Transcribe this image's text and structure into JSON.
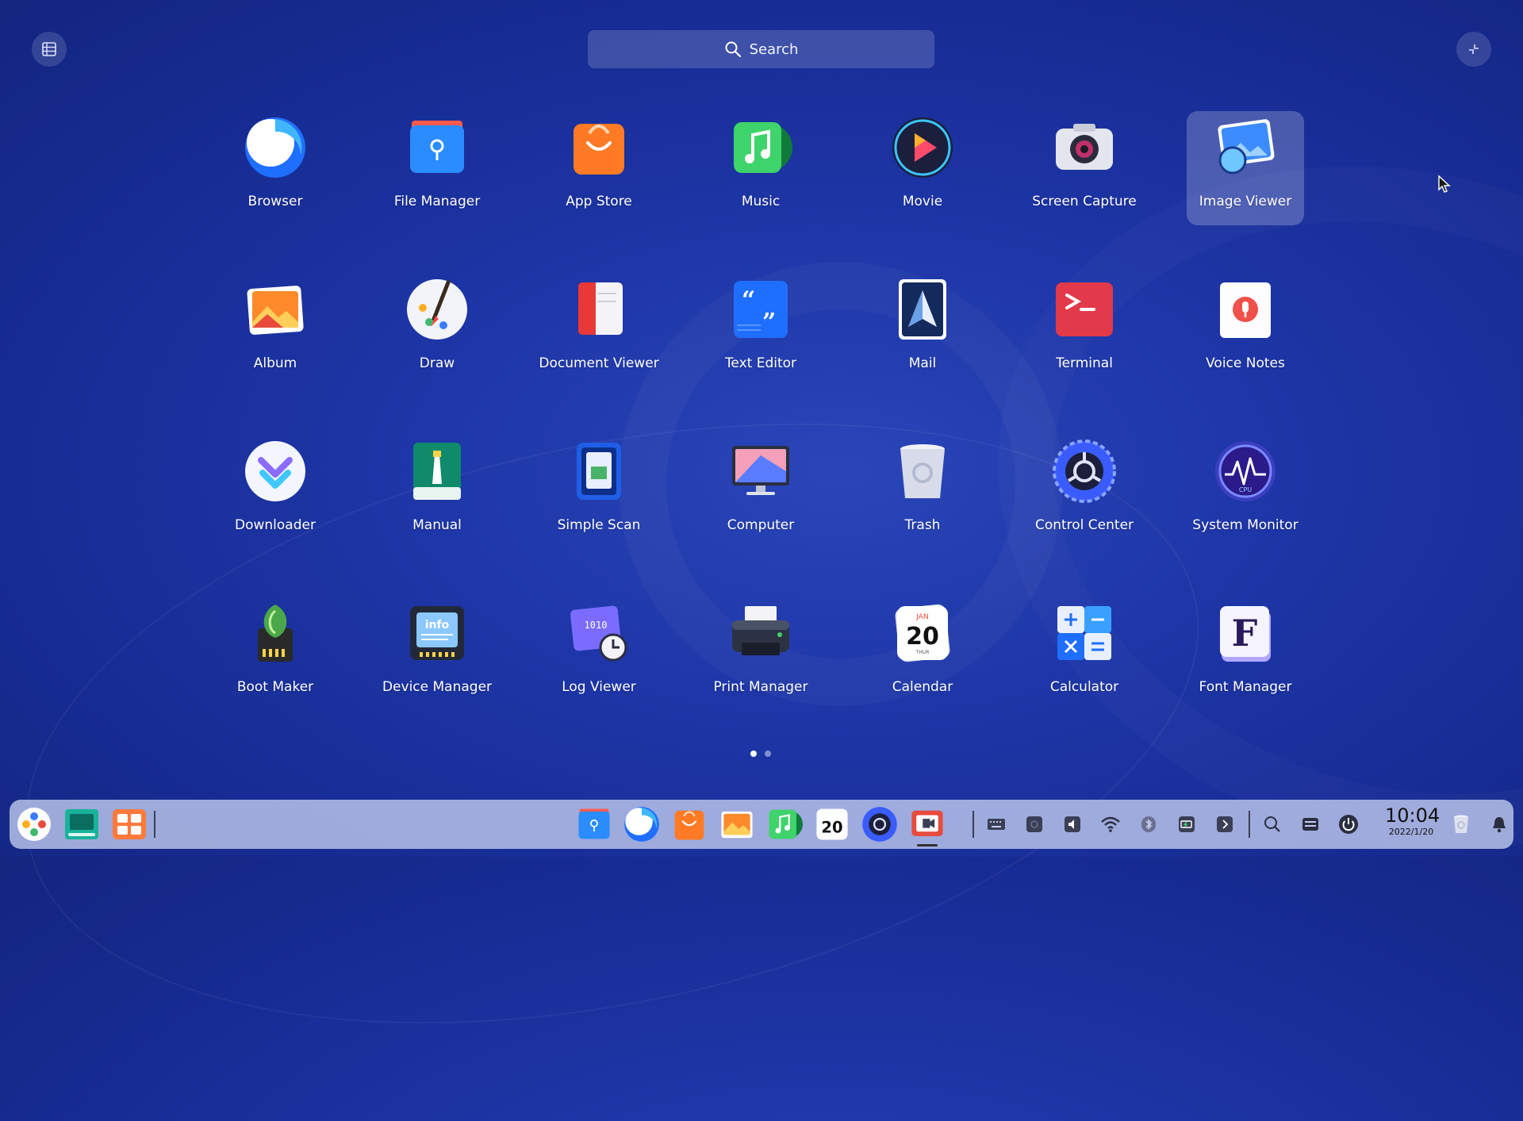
{
  "search": {
    "label": "Search"
  },
  "apps": [
    {
      "name": "Browser",
      "icon": "browser-icon"
    },
    {
      "name": "File Manager",
      "icon": "file-manager-icon"
    },
    {
      "name": "App Store",
      "icon": "app-store-icon"
    },
    {
      "name": "Music",
      "icon": "music-icon"
    },
    {
      "name": "Movie",
      "icon": "movie-icon"
    },
    {
      "name": "Screen Capture",
      "icon": "screen-capture-icon"
    },
    {
      "name": "Image Viewer",
      "icon": "image-viewer-icon",
      "selected": true
    },
    {
      "name": "Album",
      "icon": "album-icon"
    },
    {
      "name": "Draw",
      "icon": "draw-icon"
    },
    {
      "name": "Document Viewer",
      "icon": "document-viewer-icon"
    },
    {
      "name": "Text Editor",
      "icon": "text-editor-icon"
    },
    {
      "name": "Mail",
      "icon": "mail-icon"
    },
    {
      "name": "Terminal",
      "icon": "terminal-icon"
    },
    {
      "name": "Voice Notes",
      "icon": "voice-notes-icon"
    },
    {
      "name": "Downloader",
      "icon": "downloader-icon"
    },
    {
      "name": "Manual",
      "icon": "manual-icon"
    },
    {
      "name": "Simple Scan",
      "icon": "simple-scan-icon"
    },
    {
      "name": "Computer",
      "icon": "computer-icon"
    },
    {
      "name": "Trash",
      "icon": "trash-icon"
    },
    {
      "name": "Control Center",
      "icon": "control-center-icon"
    },
    {
      "name": "System Monitor",
      "icon": "system-monitor-icon"
    },
    {
      "name": "Boot Maker",
      "icon": "boot-maker-icon"
    },
    {
      "name": "Device Manager",
      "icon": "device-manager-icon"
    },
    {
      "name": "Log Viewer",
      "icon": "log-viewer-icon"
    },
    {
      "name": "Print Manager",
      "icon": "print-manager-icon"
    },
    {
      "name": "Calendar",
      "icon": "calendar-icon"
    },
    {
      "name": "Calculator",
      "icon": "calculator-icon"
    },
    {
      "name": "Font Manager",
      "icon": "font-manager-icon"
    }
  ],
  "icon_text": {
    "device_manager": "info",
    "log_viewer": "1010",
    "calendar_month": "JAN",
    "calendar_day": "20",
    "calendar_weekday": "THUR",
    "font_manager": "F",
    "system_monitor": "CPU"
  },
  "pager": {
    "pages": 2,
    "current": 1
  },
  "dock": {
    "left_apps": [
      "launcher-icon",
      "multitasking-icon",
      "workspace-icon"
    ],
    "center_apps": [
      "file-manager-icon",
      "browser-icon",
      "app-store-icon",
      "album-icon",
      "music-icon",
      "calendar-icon",
      "control-center-icon",
      "screen-recorder-icon"
    ],
    "calendar_day": "20",
    "tray": [
      "keyboard-icon",
      "record-icon",
      "volume-icon",
      "wifi-icon",
      "bluetooth-icon",
      "battery-icon",
      "expand-tray-icon"
    ],
    "time": "10:04",
    "date": "2022/1/20"
  },
  "colors": {
    "background": "#1c33a3",
    "dock": "#c4cef0",
    "accent": "#1f6fff"
  }
}
